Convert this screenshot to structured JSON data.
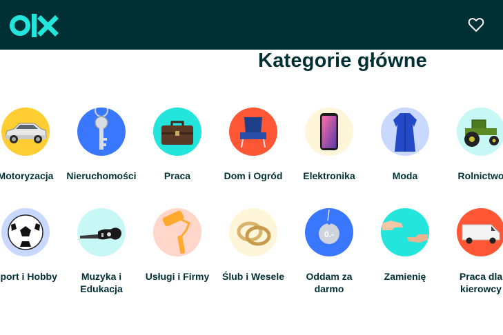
{
  "header": {
    "logo_text": "olx",
    "favorites_icon": "heart-icon",
    "background_color": "#002f34",
    "accent_color": "#23e5db"
  },
  "main": {
    "title": "Kategorie główne",
    "categories": [
      {
        "label": "Motoryzacja",
        "icon": "car-icon",
        "color": "#ffce32"
      },
      {
        "label": "Nieruchomości",
        "icon": "key-icon",
        "color": "#3a77ff"
      },
      {
        "label": "Praca",
        "icon": "briefcase-icon",
        "color": "#23e5db"
      },
      {
        "label": "Dom i Ogród",
        "icon": "armchair-icon",
        "color": "#ff5636"
      },
      {
        "label": "Elektronika",
        "icon": "smartphone-icon",
        "color": "#fff6d9"
      },
      {
        "label": "Moda",
        "icon": "dress-icon",
        "color": "#c8d8ff"
      },
      {
        "label": "Rolnictwo",
        "icon": "tractor-icon",
        "color": "#c8f8f6"
      },
      {
        "label": "Sport i Hobby",
        "icon": "soccer-ball-icon",
        "color": "#c8d8ff"
      },
      {
        "label": "Muzyka i Edukacja",
        "icon": "guitar-icon",
        "color": "#c8f8f6"
      },
      {
        "label": "Usługi i Firmy",
        "icon": "paint-roller-icon",
        "color": "#ffd6c9"
      },
      {
        "label": "Ślub i Wesele",
        "icon": "rings-icon",
        "color": "#fff6d9"
      },
      {
        "label": "Oddam za darmo",
        "icon": "price-tag-icon",
        "color": "#3a77ff",
        "badge": "0.-"
      },
      {
        "label": "Zamienię",
        "icon": "handshake-icon",
        "color": "#23e5db"
      },
      {
        "label": "Praca dla kierowcy",
        "icon": "van-icon",
        "color": "#ff5636"
      }
    ]
  }
}
